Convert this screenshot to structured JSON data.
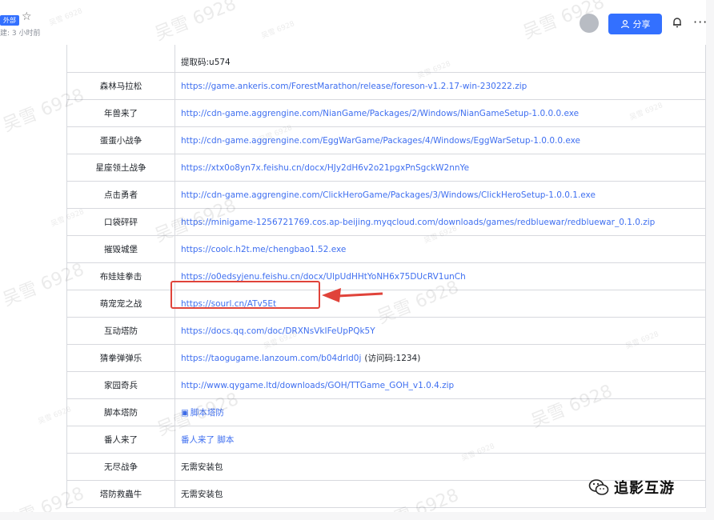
{
  "header": {
    "doc_tag": "外部",
    "subtitle": "建: 3 小时前",
    "share_label": "分享",
    "more_label": "···",
    "star_icon": "star-icon",
    "bell_icon": "bell-icon",
    "share_icon": "user-add-icon"
  },
  "table": {
    "rows": [
      {
        "name": "",
        "link": "提取码:u574",
        "type": "plain"
      },
      {
        "name": "森林马拉松",
        "link": "https://game.ankeris.com/ForestMarathon/release/foreson-v1.2.17-win-230222.zip",
        "type": "url"
      },
      {
        "name": "年兽来了",
        "link": "http://cdn-game.aggrengine.com/NianGame/Packages/2/Windows/NianGameSetup-1.0.0.0.exe",
        "type": "url"
      },
      {
        "name": "蛋蛋小战争",
        "link": "http://cdn-game.aggrengine.com/EggWarGame/Packages/4/Windows/EggWarSetup-1.0.0.0.exe",
        "type": "url"
      },
      {
        "name": "星座领土战争",
        "link": "https://xtx0o8yn7x.feishu.cn/docx/HJy2dH6v2o21pgxPnSgckW2nnYe",
        "type": "url"
      },
      {
        "name": "点击勇者",
        "link": "http://cdn-game.aggrengine.com/ClickHeroGame/Packages/3/Windows/ClickHeroSetup-1.0.0.1.exe",
        "type": "url"
      },
      {
        "name": "口袋砰砰",
        "link": "https://minigame-1256721769.cos.ap-beijing.myqcloud.com/downloads/games/redbluewar/redbluewar_0.1.0.zip",
        "type": "url"
      },
      {
        "name": "摧毁城堡",
        "link": "https://coolc.h2t.me/chengbao1.52.exe",
        "type": "url"
      },
      {
        "name": "布娃娃拳击",
        "link": "https://o0edsyjenu.feishu.cn/docx/UlpUdHHtYoNH6x75DUcRV1unCh",
        "type": "url"
      },
      {
        "name": "萌宠宠之战",
        "link": "https://sourl.cn/ATv5Et",
        "type": "url"
      },
      {
        "name": "互动塔防",
        "link": "https://docs.qq.com/doc/DRXNsVkIFeUpPQk5Y",
        "type": "url"
      },
      {
        "name": "猜拳弹弹乐",
        "link": "https://taogugame.lanzoum.com/b04drld0j",
        "extra": "(访问码:1234)",
        "type": "url"
      },
      {
        "name": "家园奇兵",
        "link": "http://www.qygame.ltd/downloads/GOH/TTGame_GOH_v1.0.4.zip",
        "type": "url"
      },
      {
        "name": "脚本塔防",
        "link": "脚本塔防",
        "type": "doc"
      },
      {
        "name": "番人来了",
        "link": "番人来了 脚本",
        "type": "url"
      },
      {
        "name": "无尽战争",
        "link": "无需安装包",
        "type": "plain"
      },
      {
        "name": "塔防救蟲牛",
        "link": "无需安装包",
        "type": "plain"
      }
    ]
  },
  "watermark": {
    "text": "吴雪 6928",
    "small": "吴雪 6928"
  },
  "brand": {
    "text": "追影互游",
    "icon": "wechat-icon"
  },
  "colors": {
    "accent": "#3370ff",
    "link": "#3f6ff0",
    "annotation": "#e0433a"
  }
}
